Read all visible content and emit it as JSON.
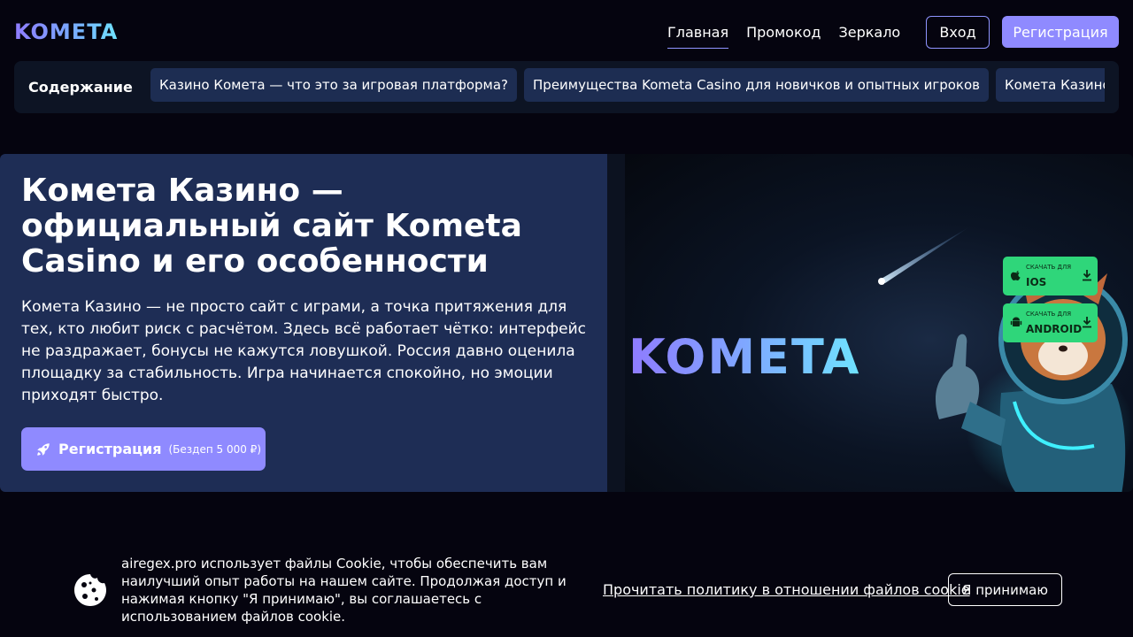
{
  "header": {
    "logo": "KOMETA",
    "nav": [
      "Главная",
      "Промокод",
      "Зеркало"
    ],
    "login_label": "Вход",
    "register_label": "Регистрация"
  },
  "toc": {
    "title": "Содержание",
    "items": [
      "Казино Комета — что это за игровая платформа?",
      "Преимущества Kometa Casino для новичков и опытных игроков",
      "Комета Казино официальный сайт"
    ]
  },
  "hero": {
    "title": "Комета Казино — официальный сайт Kometa Casino и его особенности",
    "text": "Комета Казино — не просто сайт с играми, а точка притяжения для тех, кто любит риск с расчётом. Здесь всё работает чётко: интерфейс не раздражает, бонусы не кажутся ловушкой. Россия давно оценила площадку за стабильность. Игра начинается спокойно, но эмоции приходят быстро.",
    "cta_label": "Регистрация",
    "cta_bonus": "(Бездеп 5 000 ₽)",
    "banner_brand": "KOMETA",
    "download_ios_small": "СКАЧАТЬ ДЛЯ",
    "download_ios_big": "IOS",
    "download_android_small": "СКАЧАТЬ ДЛЯ",
    "download_android_big": "ANDROID"
  },
  "cookie": {
    "text": "airegex.pro использует файлы Cookie, чтобы обеспечить вам наилучший опыт работы на нашем сайте. Продолжая доступ и нажимая кнопку \"Я принимаю\", вы соглашаетесь с использованием файлов cookie.",
    "policy_link": "Прочитать политику в отношении файлов cookie",
    "accept_label": "Я принимаю"
  },
  "colors": {
    "background": "#05040f",
    "accent": "#8f8aff",
    "hero_panel": "#1e2d55",
    "toc_chip": "#1d2d52",
    "download_green": "#2fd67a"
  }
}
